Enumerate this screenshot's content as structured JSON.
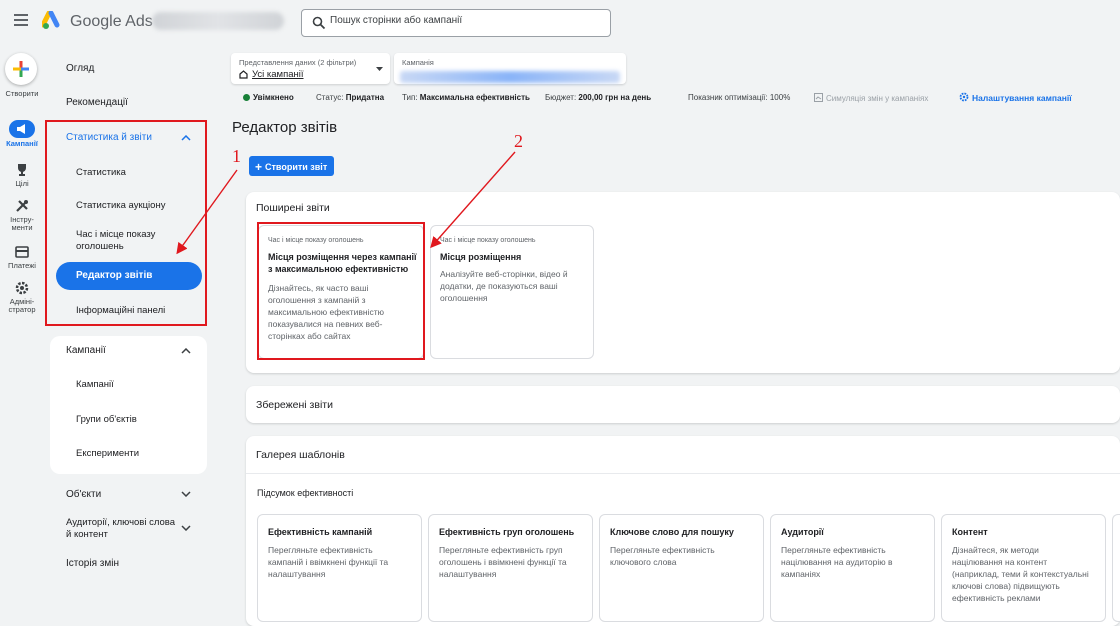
{
  "header": {
    "product_name": "Google Ads",
    "search_placeholder": "Пошук сторінки або кампанії"
  },
  "rail": {
    "create": "Створити",
    "campaigns": "Кампанії",
    "goals": "Цілі",
    "tools_line1": "Інстру-",
    "tools_line2": "менти",
    "billing": "Платежі",
    "admin_line1": "Адміні-",
    "admin_line2": "стратор"
  },
  "nav": {
    "overview": "Огляд",
    "recommendations": "Рекомендації",
    "insights_group": "Статистика й звіти",
    "insights_items": [
      "Статистика",
      "Статистика аукціону",
      "Час і місце показу оголошень",
      "Редактор звітів",
      "Інформаційні панелі"
    ],
    "campaigns_group": "Кампанії",
    "campaigns_items": [
      "Кампанії",
      "Групи об'єктів",
      "Експерименти"
    ],
    "assets": "Об'єкти",
    "audiences": "Аудиторії, ключові слова й контент",
    "change_history": "Історія змін"
  },
  "summary": {
    "view_label": "Представлення даних (2 фільтри)",
    "view_value": "Усі кампанії",
    "campaign_label": "Кампанія",
    "status_enabled": "Увімкнено",
    "status_label": "Статус:",
    "status_value": "Придатна",
    "type_label": "Тип:",
    "type_value": "Максимальна ефективність",
    "budget_label": "Бюджет:",
    "budget_value": "200,00 грн на день",
    "optimization": "Показник оптимізації: 100%",
    "simulation": "Симуляція змін у кампаніях",
    "settings": "Налаштування кампанії"
  },
  "main": {
    "page_title": "Редактор звітів",
    "create_report": "Створити звіт",
    "common_reports_title": "Поширені звіти",
    "reports": [
      {
        "category": "Час і місце показу оголошень",
        "title_lines": [
          "Місця розміщення через кампанії",
          "з максимальною ефективністю"
        ],
        "desc_lines": [
          "Дізнайтесь, як часто ваші",
          "оголошення з кампаній з",
          "максимальною ефективністю",
          "показувалися на певних веб-",
          "сторінках або сайтах"
        ]
      },
      {
        "category": "Час і місце показу оголошень",
        "title_lines": [
          "Місця розміщення"
        ],
        "desc_lines": [
          "Аналізуйте веб-сторінки, відео й",
          "додатки, де показуються ваші",
          "оголошення"
        ]
      }
    ],
    "saved_reports_title": "Збережені звіти",
    "gallery_title": "Галерея шаблонів",
    "gallery_section": "Підсумок ефективності",
    "templates": [
      {
        "title": "Ефективність кампаній",
        "desc_lines": [
          "Перегляньте ефективність",
          "кампаній і ввімкнені функції та",
          "налаштування"
        ]
      },
      {
        "title": "Ефективність груп оголошень",
        "desc_lines": [
          "Перегляньте ефективність груп",
          "оголошень і ввімкнені функції та",
          "налаштування"
        ]
      },
      {
        "title": "Ключове слово для пошуку",
        "desc_lines": [
          "Перегляньте ефективність",
          "ключового слова"
        ]
      },
      {
        "title": "Аудиторії",
        "desc_lines": [
          "Перегляньте ефективність",
          "націлювання на аудиторію в",
          "кампаніях"
        ]
      },
      {
        "title": "Контент",
        "desc_lines": [
          "Дізнайтеся, як методи",
          "націлювання на контент",
          "(наприклад, теми й контекстуальні",
          "ключові слова) підвищують",
          "ефективність реклами"
        ]
      }
    ]
  },
  "annotations": {
    "one": "1",
    "two": "2"
  },
  "colors": {
    "accent": "#1a73e8",
    "annotation_red": "#e0181e",
    "status_green": "#188038"
  }
}
